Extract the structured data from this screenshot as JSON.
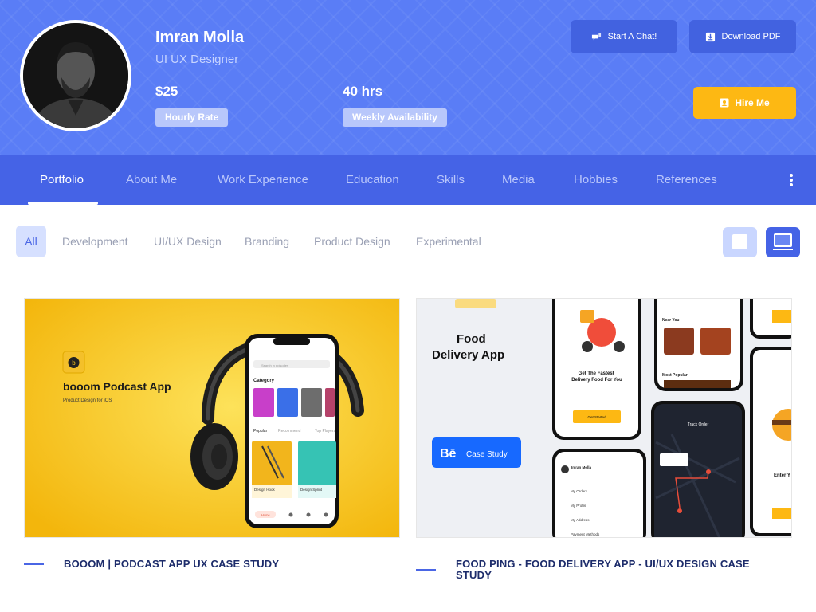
{
  "profile": {
    "name": "Imran Molla",
    "role": "UI UX Designer",
    "rate_value": "$25",
    "rate_label": "Hourly Rate",
    "hours_value": "40 hrs",
    "hours_label": "Weekly Availability"
  },
  "actions": {
    "chat_label": "Start A Chat!",
    "download_label": "Download PDF",
    "hire_label": "Hire Me"
  },
  "nav": {
    "items": [
      "Portfolio",
      "About Me",
      "Work Experience",
      "Education",
      "Skills",
      "Media",
      "Hobbies",
      "References"
    ],
    "active": "Portfolio"
  },
  "filters": {
    "items": [
      "All",
      "Development",
      "UI/UX Design",
      "Branding",
      "Product Design",
      "Experimental"
    ],
    "active": "All"
  },
  "projects": [
    {
      "title": "BOOOM | PODCAST APP UX CASE STUDY",
      "image": {
        "logo_letter": "b",
        "heading": "booom Podcast App",
        "sub": "Product Design for iOS",
        "search": "Search in episodes",
        "category": "Category",
        "tabs": [
          "Popular",
          "Recommend",
          "Top Players"
        ],
        "cards": [
          "Design Hook",
          "Design Sprint"
        ],
        "home": "Home"
      }
    },
    {
      "title": "FOOD PING - FOOD DELIVERY APP - UI/UX DESIGN CASE STUDY",
      "image": {
        "heading_line1": "Food",
        "heading_line2": "Delivery App",
        "badge_logo": "Bē",
        "badge_text": "Case Study",
        "phone1_title": "Get The Fastest Delivery Food For You",
        "phone1_cta": "Get Started",
        "near_you": "Near You",
        "most_popular": "Most Popular",
        "menu_user": "Imran Molla",
        "menu_items": [
          "My Orders",
          "My Profile",
          "My Address",
          "Payment Methods"
        ],
        "track_title": "Track Order",
        "enter": "Enter Y"
      }
    }
  ],
  "colors": {
    "header_bg": "#5a7df6",
    "nav_bg": "#4563e6",
    "accent": "#fdb813",
    "title_text": "#1d2c6b"
  }
}
